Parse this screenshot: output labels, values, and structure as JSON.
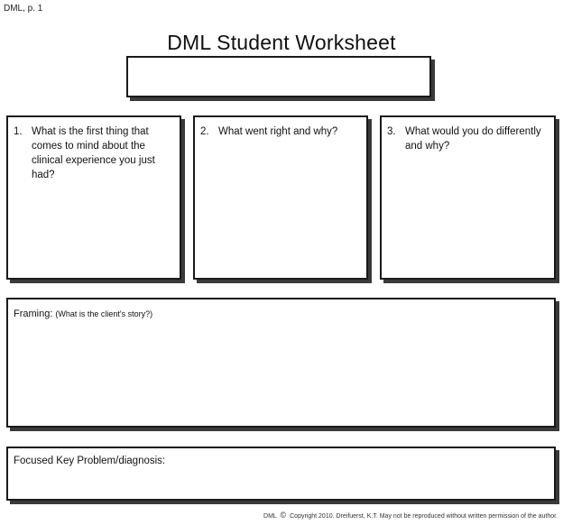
{
  "header": {
    "page_label": "DML, p. 1",
    "title": "DML Student Worksheet"
  },
  "questions": [
    {
      "number": "1.",
      "text": "What is the first thing that comes to mind about the clinical experience you just had?"
    },
    {
      "number": "2.",
      "text": "What went right and why?"
    },
    {
      "number": "3.",
      "text": "What would you do differently and why?"
    }
  ],
  "framing": {
    "label": "Framing:",
    "hint": "(What is the client's story?)"
  },
  "focused": {
    "label": "Focused Key Problem/diagnosis:"
  },
  "footer": {
    "prefix": "DML",
    "icon": "copyright-icon",
    "text": "Copyright 2010. Dreifuerst, K.T. May not be reproduced without written permission of the author."
  }
}
